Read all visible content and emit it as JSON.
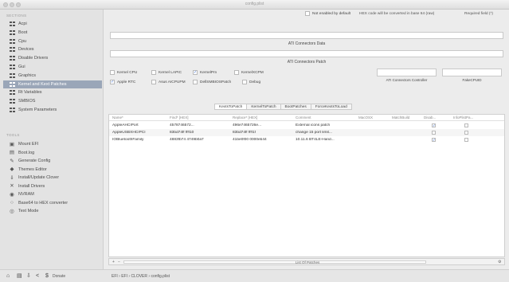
{
  "window": {
    "title": "config.plist"
  },
  "sidebar": {
    "sections_label": "SECTIONS",
    "tools_label": "TOOLS",
    "sections": [
      {
        "label": "Acpi",
        "icon": "grid-icon"
      },
      {
        "label": "Boot",
        "icon": "grid-icon"
      },
      {
        "label": "Cpu",
        "icon": "grid-icon"
      },
      {
        "label": "Devices",
        "icon": "grid-icon"
      },
      {
        "label": "Disable Drivers",
        "icon": "grid-icon"
      },
      {
        "label": "Gui",
        "icon": "grid-icon"
      },
      {
        "label": "Graphics",
        "icon": "grid-icon"
      },
      {
        "label": "Kernel and Kext Patches",
        "icon": "grid-icon",
        "selected": true
      },
      {
        "label": "Rt Variables",
        "icon": "grid-icon"
      },
      {
        "label": "SMBIOS",
        "icon": "grid-icon"
      },
      {
        "label": "System Parameters",
        "icon": "grid-icon"
      }
    ],
    "tools": [
      {
        "label": "Mount EFI",
        "icon": "disk-icon"
      },
      {
        "label": "Boot.log",
        "icon": "log-icon"
      },
      {
        "label": "Generate Config",
        "icon": "wrench-icon"
      },
      {
        "label": "Themes Editor",
        "icon": "palette-icon"
      },
      {
        "label": "Install/Update Clover",
        "icon": "download-icon"
      },
      {
        "label": "Install Drivers",
        "icon": "tools-icon"
      },
      {
        "label": "NVRAM",
        "icon": "chip-icon"
      },
      {
        "label": "Base64 to HEX converter",
        "icon": "convert-icon"
      },
      {
        "label": "Text Mode",
        "icon": "eye-icon"
      }
    ]
  },
  "bottombar": {
    "icons": [
      "home-icon",
      "document-icon",
      "import-icon",
      "share-icon",
      "donate-icon"
    ],
    "donate_label": "Donate",
    "path": "EFI  ›  EFI  ›  CLOVER  ›  config.plist"
  },
  "header_options": {
    "not_enabled_label": "Not enabled by default",
    "hex_note": "HEX code will be converted in base 64 (raw)",
    "required_label": "Required field (*)"
  },
  "connectors": {
    "data_label": "ATI Connectors Data",
    "patch_label": "ATI Connectors Patch",
    "controller_label": "ATI Connectors Controller",
    "fake_cpuid_label": "FakeCPUID",
    "checkboxes": [
      {
        "label": "Kernel CPU",
        "checked": false
      },
      {
        "label": "Kernel LAPIC",
        "checked": false
      },
      {
        "label": "KernelPm",
        "checked": true
      },
      {
        "label": "KernelXCPM",
        "checked": false
      },
      {
        "label": "Apple RTC",
        "checked": true
      },
      {
        "label": "Asus AICPUPM",
        "checked": false
      },
      {
        "label": "DellSMBIOSPatch",
        "checked": false
      },
      {
        "label": "Debug",
        "checked": false
      }
    ]
  },
  "tabs": [
    {
      "label": "KextsToPatch",
      "active": true
    },
    {
      "label": "KernelToPatch",
      "active": false
    },
    {
      "label": "BootPatches",
      "active": false
    },
    {
      "label": "ForceKextsToLoad",
      "active": false
    }
  ],
  "table": {
    "columns": [
      "Name*",
      "Find* [HEX]",
      "Replace* [HEX]",
      "Comment",
      "MacOSX",
      "MatchBuild",
      "Disab...",
      "InfoPlistPa..."
    ],
    "rows": [
      {
        "name": "AppleAHCIPort",
        "find": "4578746572...",
        "replace": "496e7465726e...",
        "comment": "External icons patch",
        "disabled": true,
        "infoplist": false
      },
      {
        "name": "AppleUSBXHCIPCI",
        "find": "83bd74ff ffff10",
        "replace": "83bd74ff ffff1f",
        "comment": "change 15 port limit...",
        "disabled": false,
        "infoplist": false
      },
      {
        "name": "IOBluetoothFamily",
        "find": "4883fb74 4749b0a7",
        "replace": "41be0f00 0000eb44",
        "comment": "10.11.6 BT4LE-Hand...",
        "disabled": true,
        "infoplist": false
      }
    ],
    "footer": "List Of Patches",
    "add_label": "+",
    "remove_label": "−"
  }
}
